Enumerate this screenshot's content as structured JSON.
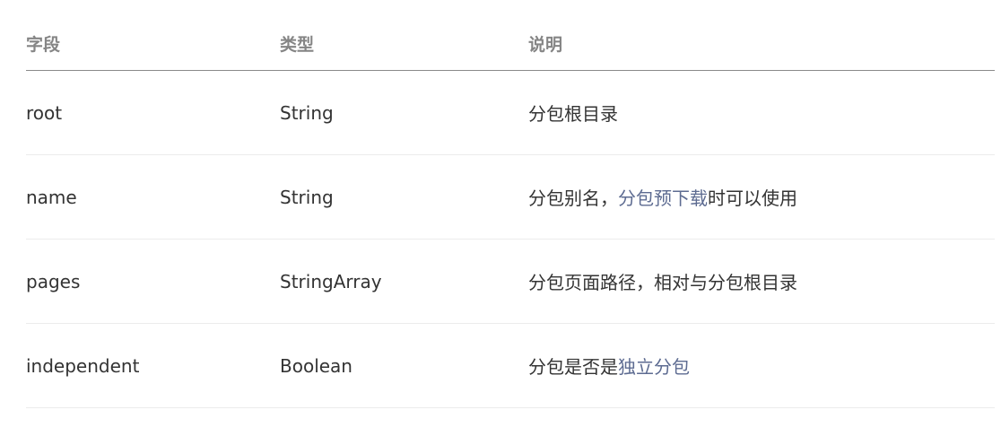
{
  "table": {
    "headers": [
      "字段",
      "类型",
      "说明"
    ],
    "rows": [
      {
        "field": "root",
        "type": "String",
        "desc_before": "分包根目录",
        "desc_link": "",
        "desc_after": ""
      },
      {
        "field": "name",
        "type": "String",
        "desc_before": "分包别名，",
        "desc_link": "分包预下载",
        "desc_after": "时可以使用"
      },
      {
        "field": "pages",
        "type": "StringArray",
        "desc_before": "分包页面路径，相对与分包根目录",
        "desc_link": "",
        "desc_after": ""
      },
      {
        "field": "independent",
        "type": "Boolean",
        "desc_before": "分包是否是",
        "desc_link": "独立分包",
        "desc_after": ""
      }
    ]
  },
  "colors": {
    "text": "#333333",
    "header_text": "#858585",
    "link": "#5d6b91",
    "header_rule": "#8a8a8a",
    "row_rule": "#ececec"
  }
}
